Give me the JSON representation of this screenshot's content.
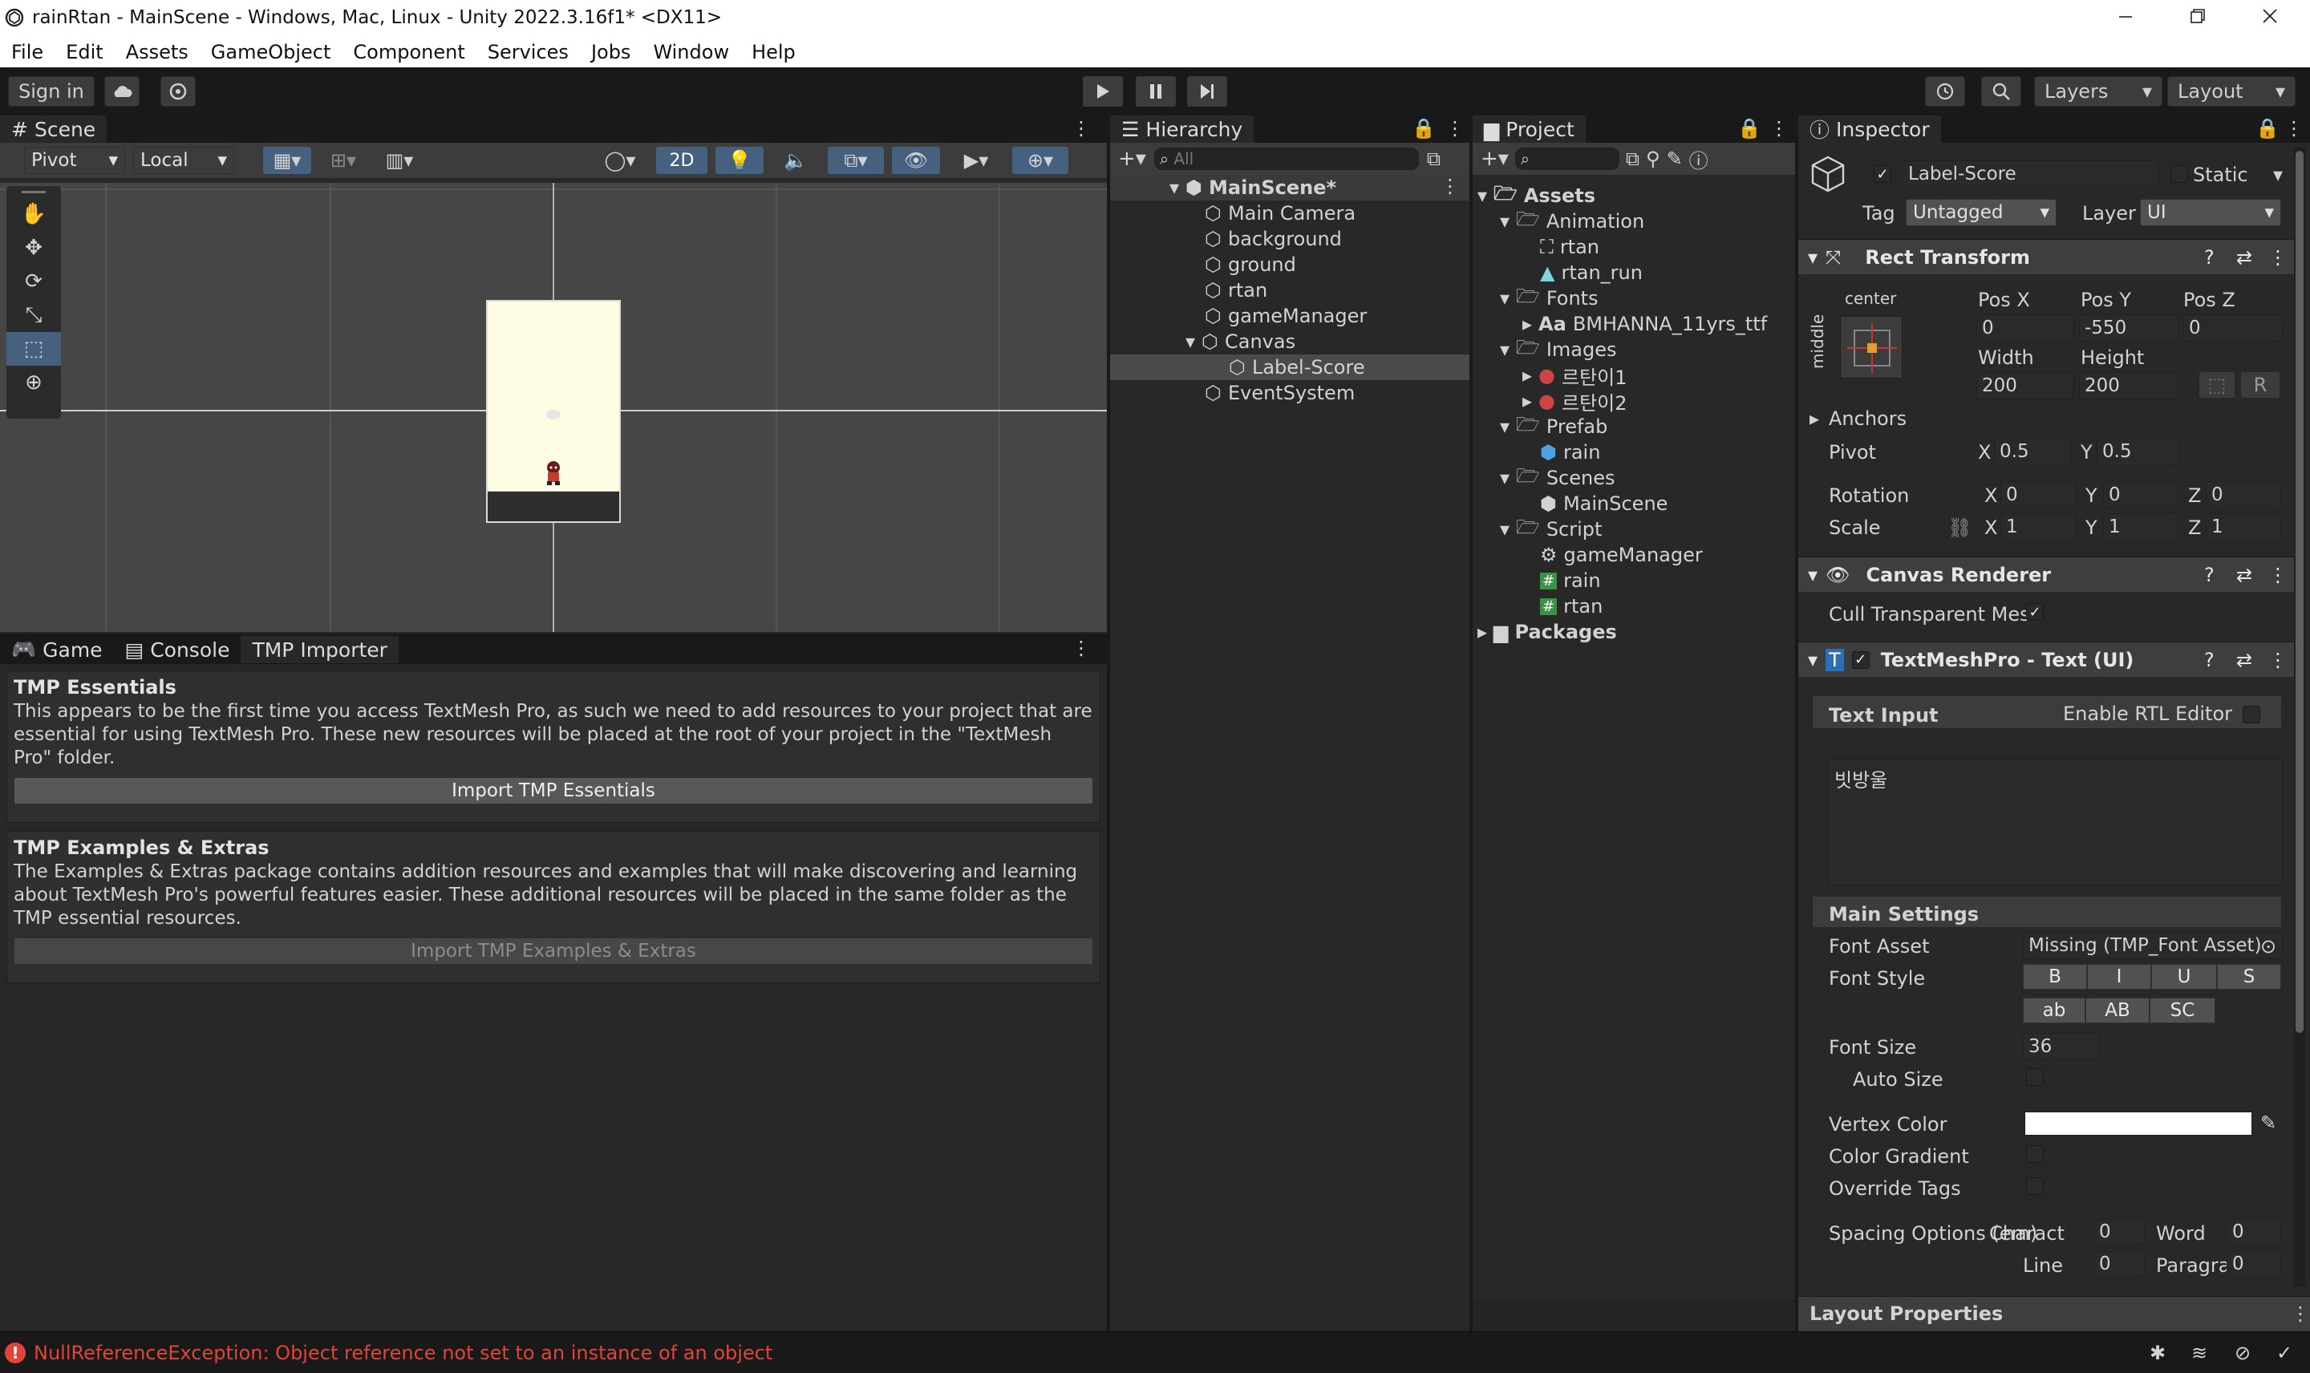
{
  "window": {
    "title": "rainRtan - MainScene - Windows, Mac, Linux - Unity 2022.3.16f1* <DX11>"
  },
  "menu": [
    "File",
    "Edit",
    "Assets",
    "GameObject",
    "Component",
    "Services",
    "Jobs",
    "Window",
    "Help"
  ],
  "toolbar": {
    "sign_in": "Sign in",
    "layers": "Layers",
    "layout": "Layout"
  },
  "scene": {
    "tab": "Scene",
    "pivot": "Pivot",
    "local": "Local",
    "mode_2d": "2D"
  },
  "hierarchy": {
    "tab": "Hierarchy",
    "search_placeholder": "All",
    "root": "MainScene*",
    "items": [
      "Main Camera",
      "background",
      "ground",
      "rtan",
      "gameManager",
      "Canvas",
      "Label-Score",
      "EventSystem"
    ]
  },
  "project": {
    "tab": "Project",
    "items": [
      "Assets",
      "Animation",
      "rtan",
      "rtan_run",
      "Fonts",
      "BMHANNA_11yrs_ttf",
      "Images",
      "르탄이1",
      "르탄이2",
      "Prefab",
      "rain",
      "Scenes",
      "MainScene",
      "Script",
      "gameManager",
      "rain",
      "rtan",
      "Packages"
    ]
  },
  "bottom": {
    "tabs": [
      "Game",
      "Console",
      "TMP Importer"
    ],
    "essentials_title": "TMP Essentials",
    "essentials_text": "This appears to be the first time you access TextMesh Pro, as such we need to add resources to your project that are essential for using TextMesh Pro. These new resources will be placed at the root of your project in the \"TextMesh Pro\" folder.",
    "essentials_button": "Import TMP Essentials",
    "extras_title": "TMP Examples & Extras",
    "extras_text": "The Examples & Extras package contains addition resources and examples that will make discovering and learning about TextMesh Pro's powerful features easier. These additional resources will be placed in the same folder as the TMP essential resources.",
    "extras_button": "Import TMP Examples & Extras"
  },
  "inspector": {
    "tab": "Inspector",
    "object_name": "Label-Score",
    "static": "Static",
    "tag_label": "Tag",
    "tag": "Untagged",
    "layer_label": "Layer",
    "layer": "UI",
    "rect_transform": {
      "title": "Rect Transform",
      "anchor_h": "center",
      "anchor_v": "middle",
      "posx_label": "Pos X",
      "posy_label": "Pos Y",
      "posz_label": "Pos Z",
      "posx": "0",
      "posy": "-550",
      "posz": "0",
      "width_label": "Width",
      "height_label": "Height",
      "width": "200",
      "height": "200",
      "r_btn": "R",
      "anchors": "Anchors",
      "pivot": "Pivot",
      "pivot_x": "0.5",
      "pivot_y": "0.5",
      "rotation": "Rotation",
      "rot_x": "0",
      "rot_y": "0",
      "rot_z": "0",
      "scale": "Scale",
      "scale_x": "1",
      "scale_y": "1",
      "scale_z": "1",
      "x": "X",
      "y": "Y",
      "z": "Z"
    },
    "canvas_renderer": {
      "title": "Canvas Renderer",
      "cull": "Cull Transparent Mes"
    },
    "tmp": {
      "title": "TextMeshPro - Text (UI)",
      "text_input": "Text Input",
      "rtl": "Enable RTL Editor",
      "text": "빗방울",
      "main_settings": "Main Settings",
      "font_asset_label": "Font Asset",
      "font_asset": "Missing (TMP_Font Asset)",
      "font_style_label": "Font Style",
      "styles": [
        "B",
        "I",
        "U",
        "S",
        "ab",
        "AB",
        "SC"
      ],
      "font_size_label": "Font Size",
      "font_size": "36",
      "auto_size": "Auto Size",
      "vertex_color": "Vertex Color",
      "color_gradient": "Color Gradient",
      "override_tags": "Override Tags",
      "spacing_label": "Spacing Options (em)",
      "character_label": "Charact",
      "character": "0",
      "word_label": "Word",
      "word": "0",
      "line_label": "Line",
      "line": "0",
      "paragraph_label": "Paragra",
      "paragraph": "0"
    },
    "layout_properties": "Layout Properties"
  },
  "status": {
    "error": "NullReferenceException: Object reference not set to an instance of an object"
  },
  "colors": {
    "accent_blue": "#3a72b0",
    "error_red": "#e0443a",
    "selection": "#3d4a5c"
  }
}
